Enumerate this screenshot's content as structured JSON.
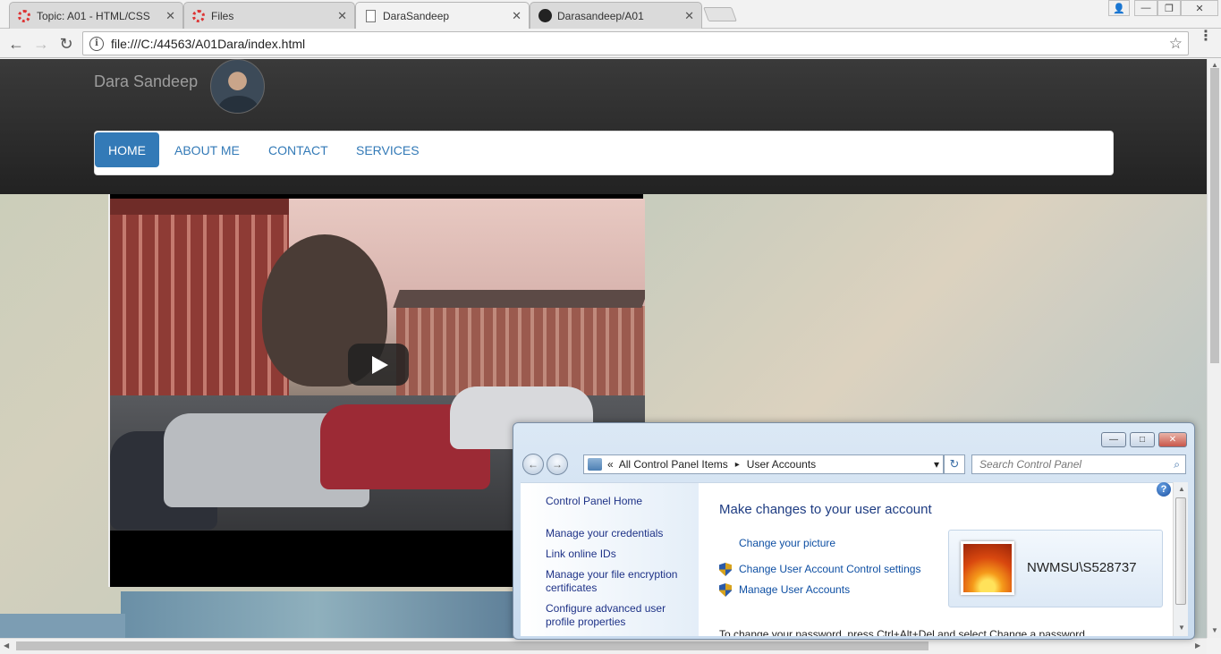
{
  "browser": {
    "tabs": [
      {
        "title": "Topic: A01 - HTML/CSS",
        "icon": "loading-ring-icon"
      },
      {
        "title": "Files",
        "icon": "loading-ring-icon"
      },
      {
        "title": "DaraSandeep",
        "icon": "document-icon",
        "active": true
      },
      {
        "title": "Darasandeep/A01",
        "icon": "github-icon"
      }
    ],
    "close_glyph": "✕",
    "url": "file:///C:/44563/A01Dara/index.html",
    "info_glyph": "i",
    "star_glyph": "☆",
    "back_glyph": "←",
    "forward_glyph": "→",
    "reload_glyph": "↻",
    "menu_glyph": "⋮",
    "window_controls": {
      "user": "👤",
      "minimize": "—",
      "restore": "❐",
      "close": "✕"
    }
  },
  "site": {
    "title": "Dara Sandeep",
    "nav": [
      "HOME",
      "ABOUT ME",
      "CONTACT",
      "SERVICES"
    ],
    "active_nav": "HOME"
  },
  "control_panel": {
    "breadcrumb_prefix": "«",
    "breadcrumb": [
      "All Control Panel Items",
      "User Accounts"
    ],
    "breadcrumb_sep": "▸",
    "dropdown_glyph": "▾",
    "search_placeholder": "Search Control Panel",
    "search_glyph": "⌕",
    "refresh_glyph": "↻",
    "help_glyph": "?",
    "left_links": [
      "Control Panel Home",
      "Manage your credentials",
      "Link online IDs",
      "Manage your file encryption certificates",
      "Configure advanced user profile properties"
    ],
    "heading": "Make changes to your user account",
    "tasks": [
      {
        "label": "Change your picture",
        "shield": false
      },
      {
        "label": "Change User Account Control settings",
        "shield": true
      },
      {
        "label": "Manage User Accounts",
        "shield": true
      }
    ],
    "username": "NWMSU\\S528737",
    "footer_text": "To change your password, press Ctrl+Alt+Del and select Change a password."
  },
  "colors": {
    "accent": "#337ab7",
    "header_bg": "#222222",
    "cp_link": "#0e4fa3"
  }
}
